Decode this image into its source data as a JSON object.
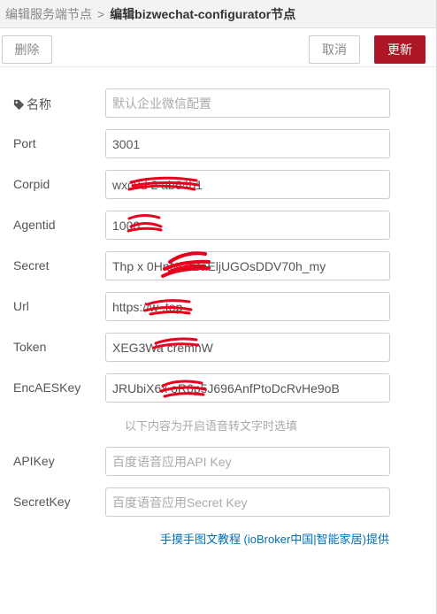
{
  "breadcrumb": {
    "parent": "编辑服务端节点",
    "separator": ">",
    "current": "编辑bizwechat-configurator节点"
  },
  "toolbar": {
    "delete_label": "删除",
    "cancel_label": "取消",
    "update_label": "更新"
  },
  "colors": {
    "accent": "#ad1625",
    "link": "#0070b4",
    "redaction": "#e8001c"
  },
  "fields": [
    {
      "label": "名称",
      "icon": "tag-icon",
      "value": "",
      "placeholder": "默认企业微信配置"
    },
    {
      "label": "Port",
      "value": "3001",
      "placeholder": ""
    },
    {
      "label": "Corpid",
      "value": "wxc0d      2      ab64b1",
      "placeholder": ""
    },
    {
      "label": "Agentid",
      "value": "1000",
      "placeholder": ""
    },
    {
      "label": "Secret",
      "value": "Thp  x      0HnNf7fBaEljUGOsDDV70h_my",
      "placeholder": ""
    },
    {
      "label": "Url",
      "value": "https://w        .top",
      "placeholder": ""
    },
    {
      "label": "Token",
      "value": "XEG3Wa      cremnW",
      "placeholder": ""
    },
    {
      "label": "EncAESKey",
      "value": "JRUbiX6x        oR6p5J696AnfPtoDcRvHe9oB",
      "placeholder": ""
    }
  ],
  "section_note": "以下内容为开启语音转文字时选填",
  "voice_fields": [
    {
      "label": "APIKey",
      "value": "",
      "placeholder": "百度语音应用API Key"
    },
    {
      "label": "SecretKey",
      "value": "",
      "placeholder": "百度语音应用Secret Key"
    }
  ],
  "tutorial_link": "手摸手图文教程 (ioBroker中国|智能家居)提供"
}
